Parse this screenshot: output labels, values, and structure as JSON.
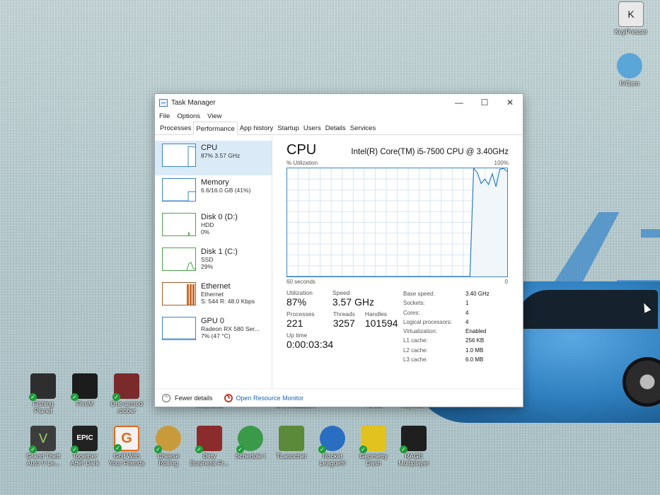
{
  "window": {
    "title": "Task Manager",
    "controls": {
      "minimize": "—",
      "maximize": "☐",
      "close": "✕"
    }
  },
  "menu": [
    "File",
    "Options",
    "View"
  ],
  "tabs": [
    "Processes",
    "Performance",
    "App history",
    "Startup",
    "Users",
    "Details",
    "Services"
  ],
  "active_tab": "Performance",
  "sidebar": [
    {
      "name": "CPU",
      "line1": "87%  3.57 GHz",
      "line2": "",
      "line3": ""
    },
    {
      "name": "Memory",
      "line1": "6.6/16.0 GB (41%)",
      "line2": "",
      "line3": ""
    },
    {
      "name": "Disk 0 (D:)",
      "line1": "HDD",
      "line2": "0%",
      "line3": ""
    },
    {
      "name": "Disk 1 (C:)",
      "line1": "SSD",
      "line2": "29%",
      "line3": ""
    },
    {
      "name": "Ethernet",
      "line1": "Ethernet",
      "line2": "S: 544  R: 48.0 Kbps",
      "line3": ""
    },
    {
      "name": "GPU 0",
      "line1": "Radeon RX 580 Ser...",
      "line2": "7%  (47 °C)",
      "line3": ""
    }
  ],
  "cpu": {
    "heading": "CPU",
    "model": "Intel(R) Core(TM) i5-7500 CPU @ 3.40GHz",
    "util_label": "% Utilization",
    "util_max": "100%",
    "axis_left": "60 seconds",
    "axis_right": "0",
    "utilization_history": [
      0,
      0,
      0,
      0,
      0,
      0,
      0,
      0,
      0,
      0,
      0,
      0,
      0,
      0,
      0,
      0,
      0,
      0,
      0,
      0,
      0,
      0,
      0,
      0,
      0,
      0,
      0,
      0,
      0,
      0,
      0,
      0,
      0,
      0,
      0,
      0,
      0,
      0,
      0,
      0,
      0,
      0,
      0,
      0,
      0,
      0,
      0,
      0,
      0,
      0,
      100,
      96,
      86,
      90,
      85,
      95,
      83,
      99,
      100,
      97
    ],
    "stats": {
      "utilization_label": "Utilization",
      "utilization": "87%",
      "speed_label": "Speed",
      "speed": "3.57 GHz",
      "processes_label": "Processes",
      "processes": "221",
      "threads_label": "Threads",
      "threads": "3257",
      "handles_label": "Handles",
      "handles": "101594",
      "uptime_label": "Up time",
      "uptime": "0:00:03:34"
    },
    "specs": [
      {
        "k": "Base speed:",
        "v": "3.40 GHz"
      },
      {
        "k": "Sockets:",
        "v": "1"
      },
      {
        "k": "Cores:",
        "v": "4"
      },
      {
        "k": "Logical processors:",
        "v": "4"
      },
      {
        "k": "Virtualization:",
        "v": "Enabled"
      },
      {
        "k": "L1 cache:",
        "v": "256 KB"
      },
      {
        "k": "L2 cache:",
        "v": "1.0 MB"
      },
      {
        "k": "L3 cache:",
        "v": "6.0 MB"
      }
    ]
  },
  "footer": {
    "fewer": "Fewer details",
    "monitor": "Open Resource Monitor"
  },
  "desktop_icons": [
    {
      "label": "KeyPresser",
      "letter": "K"
    },
    {
      "label": "IVCam",
      "letter": ""
    },
    {
      "label": "Fishing Planet",
      "letter": ""
    },
    {
      "label": "FiveM",
      "letter": ""
    },
    {
      "label": "One-armed robber",
      "letter": ""
    },
    {
      "label": "Mechanic",
      "letter": ""
    },
    {
      "label": "CHAMELEON",
      "letter": ""
    },
    {
      "label": "Forest",
      "letter": ""
    },
    {
      "label": "Keyboa...",
      "letter": ""
    },
    {
      "label": "Grand Theft Auto V Le...",
      "letter": "V"
    },
    {
      "label": "Together After Dark",
      "letter": "EPIC"
    },
    {
      "label": "Golf With Your Friends",
      "letter": "G"
    },
    {
      "label": "Cheese Rolling",
      "letter": ""
    },
    {
      "label": "Dirty Business Fr...",
      "letter": ""
    },
    {
      "label": "Schedule I",
      "letter": ""
    },
    {
      "label": "TLauncher",
      "letter": ""
    },
    {
      "label": "Rocket League®",
      "letter": ""
    },
    {
      "label": "Geometry Dash",
      "letter": ""
    },
    {
      "label": "RAGE Multiplayer",
      "letter": ""
    }
  ]
}
